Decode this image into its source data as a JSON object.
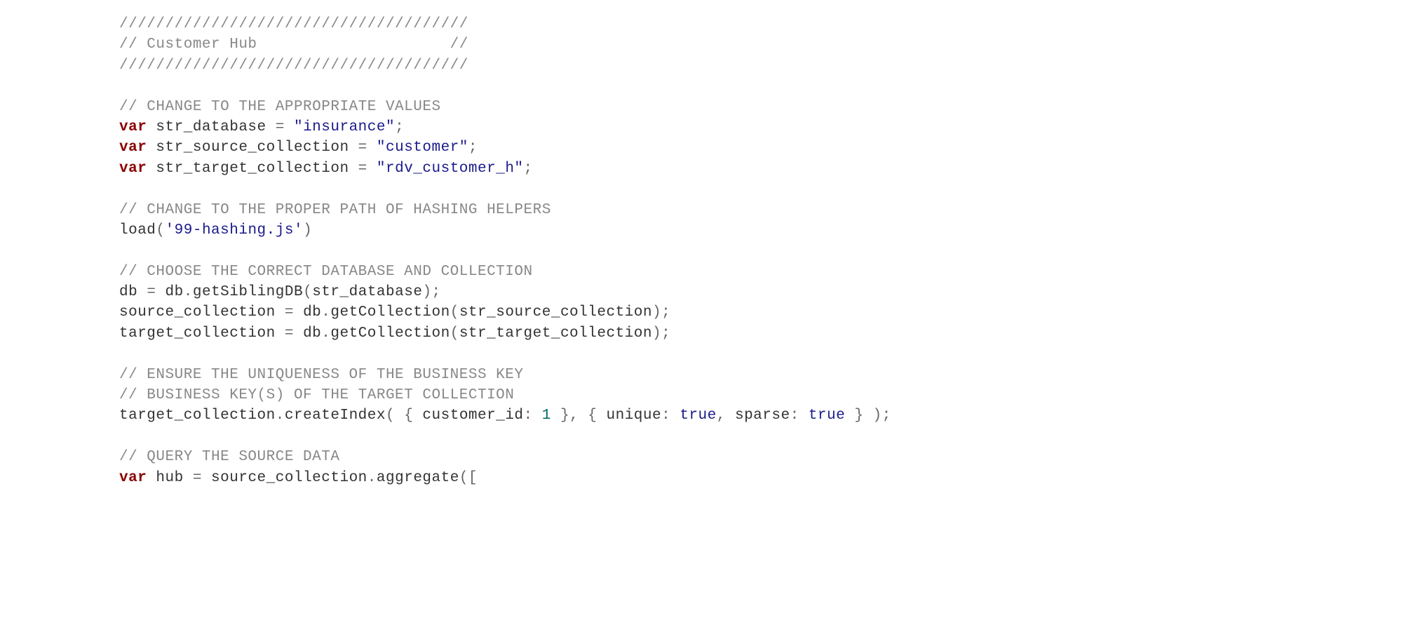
{
  "code": {
    "lines": [
      [
        {
          "cls": "comment",
          "t": "//////////////////////////////////////"
        }
      ],
      [
        {
          "cls": "comment",
          "t": "// Customer Hub                     //"
        }
      ],
      [
        {
          "cls": "comment",
          "t": "//////////////////////////////////////"
        }
      ],
      [
        {
          "cls": "",
          "t": ""
        }
      ],
      [
        {
          "cls": "comment",
          "t": "// CHANGE TO THE APPROPRIATE VALUES"
        }
      ],
      [
        {
          "cls": "keyword",
          "t": "var"
        },
        {
          "cls": "ident",
          "t": " str_database "
        },
        {
          "cls": "op",
          "t": "= "
        },
        {
          "cls": "string",
          "t": "\"insurance\""
        },
        {
          "cls": "op",
          "t": ";"
        }
      ],
      [
        {
          "cls": "keyword",
          "t": "var"
        },
        {
          "cls": "ident",
          "t": " str_source_collection "
        },
        {
          "cls": "op",
          "t": "= "
        },
        {
          "cls": "string",
          "t": "\"customer\""
        },
        {
          "cls": "op",
          "t": ";"
        }
      ],
      [
        {
          "cls": "keyword",
          "t": "var"
        },
        {
          "cls": "ident",
          "t": " str_target_collection "
        },
        {
          "cls": "op",
          "t": "= "
        },
        {
          "cls": "string",
          "t": "\"rdv_customer_h\""
        },
        {
          "cls": "op",
          "t": ";"
        }
      ],
      [
        {
          "cls": "",
          "t": ""
        }
      ],
      [
        {
          "cls": "comment",
          "t": "// CHANGE TO THE PROPER PATH OF HASHING HELPERS"
        }
      ],
      [
        {
          "cls": "func",
          "t": "load"
        },
        {
          "cls": "op",
          "t": "("
        },
        {
          "cls": "string",
          "t": "'99-hashing.js'"
        },
        {
          "cls": "op",
          "t": ")"
        }
      ],
      [
        {
          "cls": "",
          "t": ""
        }
      ],
      [
        {
          "cls": "comment",
          "t": "// CHOOSE THE CORRECT DATABASE AND COLLECTION"
        }
      ],
      [
        {
          "cls": "ident",
          "t": "db "
        },
        {
          "cls": "op",
          "t": "= "
        },
        {
          "cls": "ident",
          "t": "db"
        },
        {
          "cls": "op",
          "t": "."
        },
        {
          "cls": "func",
          "t": "getSiblingDB"
        },
        {
          "cls": "op",
          "t": "("
        },
        {
          "cls": "ident",
          "t": "str_database"
        },
        {
          "cls": "op",
          "t": ");"
        }
      ],
      [
        {
          "cls": "ident",
          "t": "source_collection "
        },
        {
          "cls": "op",
          "t": "= "
        },
        {
          "cls": "ident",
          "t": "db"
        },
        {
          "cls": "op",
          "t": "."
        },
        {
          "cls": "func",
          "t": "getCollection"
        },
        {
          "cls": "op",
          "t": "("
        },
        {
          "cls": "ident",
          "t": "str_source_collection"
        },
        {
          "cls": "op",
          "t": ");"
        }
      ],
      [
        {
          "cls": "ident",
          "t": "target_collection "
        },
        {
          "cls": "op",
          "t": "= "
        },
        {
          "cls": "ident",
          "t": "db"
        },
        {
          "cls": "op",
          "t": "."
        },
        {
          "cls": "func",
          "t": "getCollection"
        },
        {
          "cls": "op",
          "t": "("
        },
        {
          "cls": "ident",
          "t": "str_target_collection"
        },
        {
          "cls": "op",
          "t": ");"
        }
      ],
      [
        {
          "cls": "",
          "t": ""
        }
      ],
      [
        {
          "cls": "comment",
          "t": "// ENSURE THE UNIQUENESS OF THE BUSINESS KEY"
        }
      ],
      [
        {
          "cls": "comment",
          "t": "// BUSINESS KEY(S) OF THE TARGET COLLECTION"
        }
      ],
      [
        {
          "cls": "ident",
          "t": "target_collection"
        },
        {
          "cls": "op",
          "t": "."
        },
        {
          "cls": "func",
          "t": "createIndex"
        },
        {
          "cls": "op",
          "t": "( { "
        },
        {
          "cls": "ident",
          "t": "customer_id"
        },
        {
          "cls": "op",
          "t": ": "
        },
        {
          "cls": "number",
          "t": "1"
        },
        {
          "cls": "op",
          "t": " }, { "
        },
        {
          "cls": "ident",
          "t": "unique"
        },
        {
          "cls": "op",
          "t": ": "
        },
        {
          "cls": "bool",
          "t": "true"
        },
        {
          "cls": "op",
          "t": ", "
        },
        {
          "cls": "ident",
          "t": "sparse"
        },
        {
          "cls": "op",
          "t": ": "
        },
        {
          "cls": "bool",
          "t": "true"
        },
        {
          "cls": "op",
          "t": " } );"
        }
      ],
      [
        {
          "cls": "",
          "t": ""
        }
      ],
      [
        {
          "cls": "comment",
          "t": "// QUERY THE SOURCE DATA"
        }
      ],
      [
        {
          "cls": "keyword",
          "t": "var"
        },
        {
          "cls": "ident",
          "t": " hub "
        },
        {
          "cls": "op",
          "t": "= "
        },
        {
          "cls": "ident",
          "t": "source_collection"
        },
        {
          "cls": "op",
          "t": "."
        },
        {
          "cls": "func",
          "t": "aggregate"
        },
        {
          "cls": "op",
          "t": "(["
        }
      ]
    ]
  }
}
